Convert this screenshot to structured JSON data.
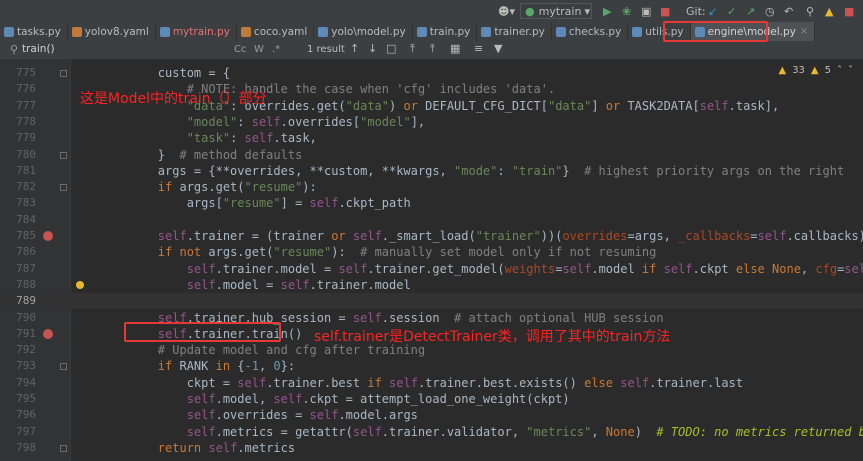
{
  "toolbar": {
    "run_config": "mytrain",
    "git_label": "Git:",
    "colors": {
      "run": "#59a869",
      "debug": "#59a869",
      "stop": "#c75450",
      "git_update": "#3592c4",
      "git_commit": "#59a869",
      "git_push": "#59a869"
    }
  },
  "tabs": [
    {
      "label": "tasks.py",
      "icon": "python-file-icon",
      "active": false,
      "modified": false
    },
    {
      "label": "yolov8.yaml",
      "icon": "yaml-file-icon",
      "active": false,
      "modified": false
    },
    {
      "label": "mytrain.py",
      "icon": "python-file-icon",
      "active": false,
      "modified": true
    },
    {
      "label": "coco.yaml",
      "icon": "yaml-file-icon",
      "active": false,
      "modified": false
    },
    {
      "label": "yolo\\model.py",
      "icon": "python-file-icon",
      "active": false,
      "modified": false
    },
    {
      "label": "train.py",
      "icon": "python-file-icon",
      "active": false,
      "modified": false
    },
    {
      "label": "trainer.py",
      "icon": "python-file-icon",
      "active": false,
      "modified": false
    },
    {
      "label": "checks.py",
      "icon": "python-file-icon",
      "active": false,
      "modified": false
    },
    {
      "label": "utils.py",
      "icon": "python-file-icon",
      "active": false,
      "modified": false
    },
    {
      "label": "engine\\model.py",
      "icon": "python-file-icon",
      "active": true,
      "modified": false
    }
  ],
  "find": {
    "query": "train()",
    "match_case": "Cc",
    "words": "W",
    "regex": ".*",
    "results": "1 result"
  },
  "inspections": {
    "warnings": "33",
    "weak_warnings": "5"
  },
  "annotations": {
    "note_top": "这是Model中的train（）部分",
    "note_mid": "self.trainer是DetectTrainer类，调用了其中的train方法"
  },
  "lines": [
    {
      "n": "775",
      "code": "        custom = {"
    },
    {
      "n": "776",
      "code": "            # NOTE: handle the case when 'cfg' includes 'data'."
    },
    {
      "n": "777",
      "code": "            \"data\": overrides.get(\"data\") or DEFAULT_CFG_DICT[\"data\"] or TASK2DATA[self.task],"
    },
    {
      "n": "778",
      "code": "            \"model\": self.overrides[\"model\"],"
    },
    {
      "n": "779",
      "code": "            \"task\": self.task,"
    },
    {
      "n": "780",
      "code": "        }  # method defaults"
    },
    {
      "n": "781",
      "code": "        args = {**overrides, **custom, **kwargs, \"mode\": \"train\"}  # highest priority args on the right"
    },
    {
      "n": "782",
      "code": "        if args.get(\"resume\"):"
    },
    {
      "n": "783",
      "code": "            args[\"resume\"] = self.ckpt_path"
    },
    {
      "n": "784",
      "code": ""
    },
    {
      "n": "785",
      "code": "        self.trainer = (trainer or self._smart_load(\"trainer\"))(overrides=args, _callbacks=self.callbacks)"
    },
    {
      "n": "786",
      "code": "        if not args.get(\"resume\"):  # manually set model only if not resuming"
    },
    {
      "n": "787",
      "code": "            self.trainer.model = self.trainer.get_model(weights=self.model if self.ckpt else None, cfg=self.m"
    },
    {
      "n": "788",
      "code": "            self.model = self.trainer.model"
    },
    {
      "n": "789",
      "code": ""
    },
    {
      "n": "790",
      "code": "        self.trainer.hub_session = self.session  # attach optional HUB session"
    },
    {
      "n": "791",
      "code": "        self.trainer.train()"
    },
    {
      "n": "792",
      "code": "        # Update model and cfg after training"
    },
    {
      "n": "793",
      "code": "        if RANK in {-1, 0}:"
    },
    {
      "n": "794",
      "code": "            ckpt = self.trainer.best if self.trainer.best.exists() else self.trainer.last"
    },
    {
      "n": "795",
      "code": "            self.model, self.ckpt = attempt_load_one_weight(ckpt)"
    },
    {
      "n": "796",
      "code": "            self.overrides = self.model.args"
    },
    {
      "n": "797",
      "code": "            self.metrics = getattr(self.trainer.validator, \"metrics\", None)  # TODO: no metrics returned by D"
    },
    {
      "n": "798",
      "code": "        return self.metrics"
    }
  ]
}
